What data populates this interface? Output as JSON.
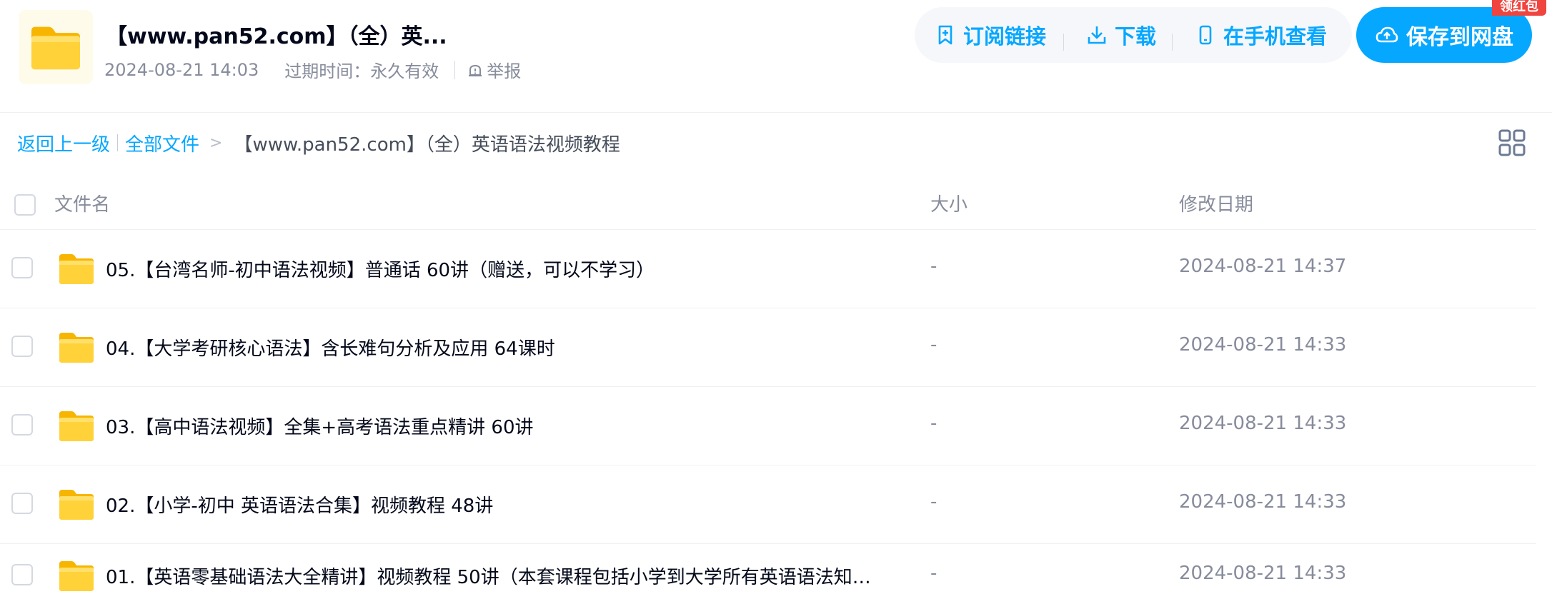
{
  "header": {
    "title": "【www.pan52.com】（全）英...",
    "created": "2024-08-21 14:03",
    "expire_text": "过期时间：永久有效",
    "report_label": "举报",
    "actions": {
      "subscribe": "订阅链接",
      "download": "下载",
      "mobile": "在手机查看"
    },
    "save_label": "保存到网盘",
    "red_packet_badge": "领红包"
  },
  "breadcrumb": {
    "back": "返回上一级",
    "all_files": "全部文件",
    "separator": ">",
    "current": "【www.pan52.com】（全）英语语法视频教程"
  },
  "table": {
    "columns": {
      "name": "文件名",
      "size": "大小",
      "date": "修改日期"
    },
    "rows": [
      {
        "name": "05.【台湾名师-初中语法视频】普通话 60讲（赠送，可以不学习）",
        "size": "-",
        "date": "2024-08-21 14:37"
      },
      {
        "name": "04.【大学考研核心语法】含长难句分析及应用 64课时",
        "size": "-",
        "date": "2024-08-21 14:33"
      },
      {
        "name": "03.【高中语法视频】全集+高考语法重点精讲 60讲",
        "size": "-",
        "date": "2024-08-21 14:33"
      },
      {
        "name": "02.【小学-初中 英语语法合集】视频教程 48讲",
        "size": "-",
        "date": "2024-08-21 14:33"
      },
      {
        "name": "01.【英语零基础语法大全精讲】视频教程 50讲（本套课程包括小学到大学所有英语语法知识...",
        "size": "-",
        "date": "2024-08-21 14:33"
      }
    ]
  },
  "colors": {
    "accent": "#06a7ff",
    "badge": "#f0443f",
    "folder": "#ffc83d"
  },
  "icons": {
    "folder": "folder-icon",
    "subscribe": "bookmark-plus-icon",
    "download": "download-icon",
    "mobile": "phone-icon",
    "save": "cloud-upload-icon",
    "report": "alert-icon",
    "view_toggle": "grid-view-icon"
  }
}
